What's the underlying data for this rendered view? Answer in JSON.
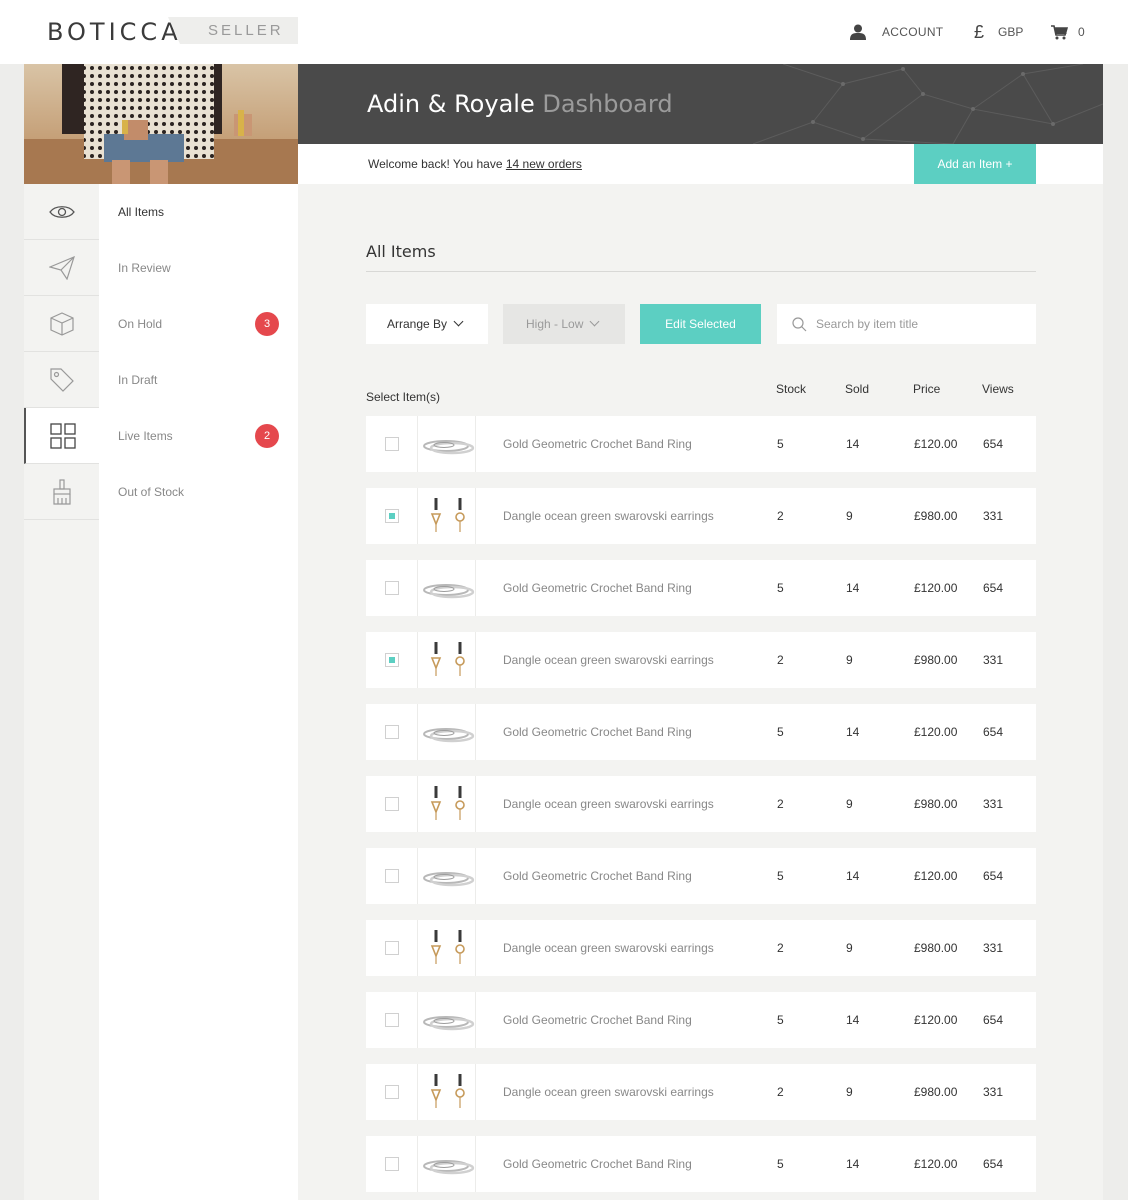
{
  "brand": {
    "name": "BOTICCA",
    "tag": "SELLER"
  },
  "topnav": {
    "account": "ACCOUNT",
    "currency_symbol": "£",
    "currency": "GBP",
    "cart_count": "0"
  },
  "sidebar": {
    "items": [
      {
        "label": "All Items",
        "icon": "eye-icon",
        "badge": ""
      },
      {
        "label": "In Review",
        "icon": "paper-plane-icon",
        "badge": ""
      },
      {
        "label": "On Hold",
        "icon": "box-icon",
        "badge": "3"
      },
      {
        "label": "In Draft",
        "icon": "tag-icon",
        "badge": ""
      },
      {
        "label": "Live Items",
        "icon": "grid-icon",
        "badge": "2"
      },
      {
        "label": "Out of Stock",
        "icon": "brush-icon",
        "badge": ""
      }
    ]
  },
  "header": {
    "store": "Adin & Royale",
    "title": "Dashboard",
    "welcome_prefix": "Welcome back! You have ",
    "welcome_link": "14 new orders",
    "add_button": "Add an Item  +"
  },
  "main": {
    "section_title": "All Items",
    "arrange_label": "Arrange By",
    "sort_value": "High - Low",
    "edit_button": "Edit Selected",
    "search_placeholder": "Search by item title",
    "columns": {
      "select": "Select Item(s)",
      "stock": "Stock",
      "sold": "Sold",
      "price": "Price",
      "views": "Views"
    },
    "rows": [
      {
        "title": "Gold Geometric Crochet Band Ring",
        "stock": "5",
        "sold": "14",
        "price": "£120.00",
        "views": "654",
        "checked": false,
        "thumb": "ring"
      },
      {
        "title": "Dangle ocean green swarovski earrings",
        "stock": "2",
        "sold": "9",
        "price": "£980.00",
        "views": "331",
        "checked": true,
        "thumb": "earrings"
      },
      {
        "title": "Gold Geometric Crochet Band Ring",
        "stock": "5",
        "sold": "14",
        "price": "£120.00",
        "views": "654",
        "checked": false,
        "thumb": "ring"
      },
      {
        "title": "Dangle ocean green swarovski earrings",
        "stock": "2",
        "sold": "9",
        "price": "£980.00",
        "views": "331",
        "checked": true,
        "thumb": "earrings"
      },
      {
        "title": "Gold Geometric Crochet Band Ring",
        "stock": "5",
        "sold": "14",
        "price": "£120.00",
        "views": "654",
        "checked": false,
        "thumb": "ring"
      },
      {
        "title": "Dangle ocean green swarovski earrings",
        "stock": "2",
        "sold": "9",
        "price": "£980.00",
        "views": "331",
        "checked": false,
        "thumb": "earrings"
      },
      {
        "title": "Gold Geometric Crochet Band Ring",
        "stock": "5",
        "sold": "14",
        "price": "£120.00",
        "views": "654",
        "checked": false,
        "thumb": "ring"
      },
      {
        "title": "Dangle ocean green swarovski earrings",
        "stock": "2",
        "sold": "9",
        "price": "£980.00",
        "views": "331",
        "checked": false,
        "thumb": "earrings"
      },
      {
        "title": "Gold Geometric Crochet Band Ring",
        "stock": "5",
        "sold": "14",
        "price": "£120.00",
        "views": "654",
        "checked": false,
        "thumb": "ring"
      },
      {
        "title": "Dangle ocean green swarovski earrings",
        "stock": "2",
        "sold": "9",
        "price": "£980.00",
        "views": "331",
        "checked": false,
        "thumb": "earrings"
      },
      {
        "title": "Gold Geometric Crochet Band Ring",
        "stock": "5",
        "sold": "14",
        "price": "£120.00",
        "views": "654",
        "checked": false,
        "thumb": "ring"
      }
    ]
  },
  "colors": {
    "accent": "#5ccfc2",
    "badge": "#e5484d",
    "banner": "#4a4a4a"
  }
}
